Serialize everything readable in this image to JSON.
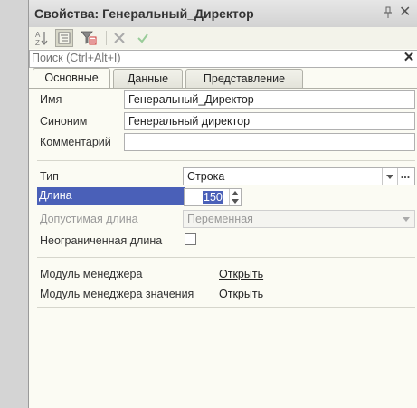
{
  "window": {
    "title": "Свойства: Генеральный_Директор"
  },
  "toolbar": {
    "buttons": [
      {
        "icon": "sort-az-icon"
      },
      {
        "icon": "categories-icon"
      },
      {
        "icon": "filter-icon"
      },
      {
        "icon": "cancel-x-icon"
      },
      {
        "icon": "apply-check-icon"
      }
    ]
  },
  "search": {
    "placeholder": "Поиск (Ctrl+Alt+I)",
    "value": ""
  },
  "tabs": [
    {
      "label": "Основные",
      "active": true
    },
    {
      "label": "Данные",
      "active": false
    },
    {
      "label": "Представление",
      "active": false
    }
  ],
  "fields": {
    "name": {
      "label": "Имя",
      "value": "Генеральный_Директор"
    },
    "synonym": {
      "label": "Синоним",
      "value": "Генеральный директор"
    },
    "comment": {
      "label": "Комментарий",
      "value": ""
    },
    "type": {
      "label": "Тип",
      "value": "Строка"
    },
    "length": {
      "label": "Длина",
      "value": "150"
    },
    "allowed_length": {
      "label": "Допустимая длина",
      "value": "Переменная"
    },
    "unlimited_length": {
      "label": "Неограниченная длина",
      "checked": false
    },
    "manager_module": {
      "label": "Модуль менеджера",
      "link": "Открыть"
    },
    "value_manager_module": {
      "label": "Модуль менеджера значения",
      "link": "Открыть"
    }
  },
  "colors": {
    "selection": "#4a60b8",
    "panel_bg": "#fbfbf3"
  }
}
